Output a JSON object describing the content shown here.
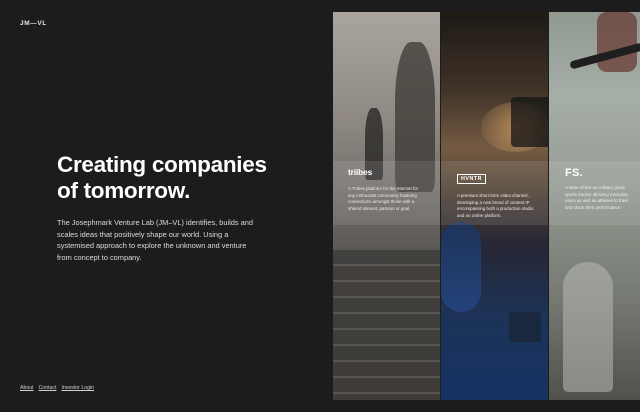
{
  "header": {
    "logo": "JM—VL"
  },
  "hero": {
    "headline_line1": "Creating companies",
    "headline_line2": "of tomorrow.",
    "intro": "The Josephmark Venture Lab (JM–VL) identifies, builds and scales ideas that positively shape our world. Using a systemised approach to explore the unknown and venture from concept to company."
  },
  "footer": {
    "links": [
      "About",
      "Contact",
      "Investor Login"
    ]
  },
  "ventures": [
    {
      "name": "triibes",
      "description": "A Triibes platform for the Internet for any enthusiast community fostering connections amongst those with a shared interest, passion or goal."
    },
    {
      "name": "HVNTR",
      "description": "A premium short-form video channel, developing a new breed of content IP encompassing both a production studio and an online platform."
    },
    {
      "name": "FS.",
      "description": "A state-of-the-art military-grade sports tracker allowing everyday users as well as athletes to track and share their performance."
    }
  ],
  "colors": {
    "background": "#1c1c1c",
    "text": "#ffffff",
    "hvntr_blue": "#173a78"
  }
}
